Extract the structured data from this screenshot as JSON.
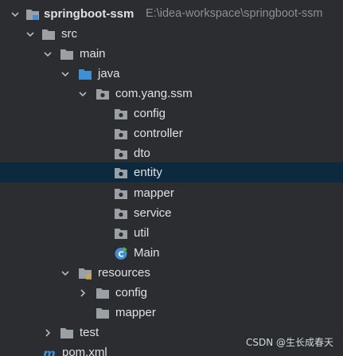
{
  "colors": {
    "background": "#2b2d30",
    "selection": "#0d293e",
    "folder_gray": "#9aa0a6",
    "folder_blue": "#3f8fd2",
    "resources_accent": "#d6a83a",
    "text": "#dfe1e5",
    "path_text": "#8c8f96"
  },
  "tree": {
    "root": {
      "label": "springboot-ssm",
      "path": "E:\\idea-workspace\\springboot-ssm",
      "icon": "module-folder-icon"
    },
    "src": {
      "label": "src",
      "icon": "folder-icon"
    },
    "main": {
      "label": "main",
      "icon": "folder-icon"
    },
    "java": {
      "label": "java",
      "icon": "source-folder-icon"
    },
    "package": {
      "label": "com.yang.ssm",
      "icon": "package-icon"
    },
    "config": {
      "label": "config",
      "icon": "package-icon"
    },
    "controller": {
      "label": "controller",
      "icon": "package-icon"
    },
    "dto": {
      "label": "dto",
      "icon": "package-icon"
    },
    "entity": {
      "label": "entity",
      "icon": "package-icon",
      "selected": true
    },
    "mapper": {
      "label": "mapper",
      "icon": "package-icon"
    },
    "service": {
      "label": "service",
      "icon": "package-icon"
    },
    "util": {
      "label": "util",
      "icon": "package-icon"
    },
    "main_class": {
      "label": "Main",
      "icon": "java-class-icon"
    },
    "resources": {
      "label": "resources",
      "icon": "resources-folder-icon"
    },
    "res_config": {
      "label": "config",
      "icon": "folder-icon"
    },
    "res_mapper": {
      "label": "mapper",
      "icon": "folder-icon"
    },
    "test": {
      "label": "test",
      "icon": "folder-icon"
    },
    "pom": {
      "label": "pom.xml",
      "icon": "maven-icon"
    }
  },
  "watermark": "CSDN @生长成春天"
}
